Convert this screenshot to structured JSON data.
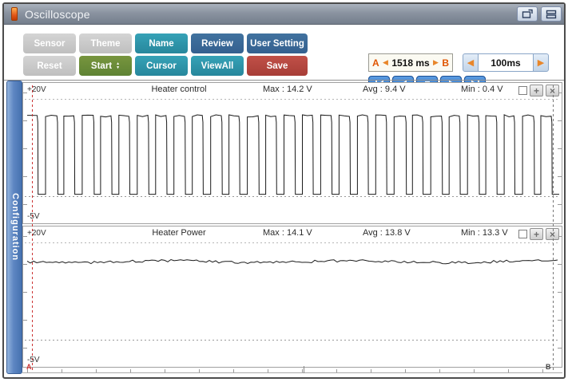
{
  "window": {
    "title": "Oscilloscope"
  },
  "toolbar": {
    "buttons": [
      {
        "label": "Sensor",
        "style": "gray"
      },
      {
        "label": "Theme",
        "style": "gray"
      },
      {
        "label": "Name",
        "style": "teal"
      },
      {
        "label": "Review",
        "style": "blue"
      },
      {
        "label": "User Setting",
        "style": "blue"
      },
      {
        "label": "Reset",
        "style": "gray"
      },
      {
        "label": "Start",
        "style": "green"
      },
      {
        "label": "Cursor",
        "style": "teal"
      },
      {
        "label": "ViewAll",
        "style": "teal"
      },
      {
        "label": "Save",
        "style": "red"
      }
    ],
    "range": {
      "a": "A",
      "value": "1518 ms",
      "b": "B"
    },
    "interval": {
      "value": "100ms"
    }
  },
  "sidebar": {
    "label": "Configuration"
  },
  "charts": [
    {
      "y_top": "+20V",
      "y_bottom": "-5V",
      "name": "Heater control",
      "max": "Max : 14.2 V",
      "avg": "Avg : 9.4 V",
      "min": "Min : 0.4 V"
    },
    {
      "y_top": "+20V",
      "y_bottom": "-5V",
      "name": "Heater Power",
      "max": "Max : 14.1 V",
      "avg": "Avg : 13.8 V",
      "min": "Min : 13.3 V"
    }
  ],
  "cursors": {
    "a": "A",
    "b": "B"
  },
  "icons": {
    "prev": "◀",
    "next": "▶",
    "up": "▲",
    "down": "▼",
    "plus": "+",
    "close": "×"
  },
  "colors": {
    "teal": "#2e96ad",
    "blue": "#39659b",
    "green": "#6a8f3c",
    "red": "#b7473f",
    "gray": "#c6c6c6",
    "playback_blue": "#2f74c8",
    "accent_orange": "#e05a00",
    "cursor_a": "#cc3333",
    "cursor_b": "#777777",
    "sidebar_blue": "#5d86c2"
  },
  "chart_data": [
    {
      "type": "line",
      "name": "Heater control",
      "waveform": "square",
      "unit": "V",
      "high_v": 14.2,
      "low_v": 0.4,
      "max_v": 14.2,
      "avg_v": 9.4,
      "min_v": 0.4,
      "cycles": 29,
      "duty": 0.57,
      "ylim": [
        -5,
        20
      ],
      "window_ms": 1518,
      "sample_interval": "100ms"
    },
    {
      "type": "line",
      "name": "Heater Power",
      "waveform": "noisy-flat",
      "unit": "V",
      "level_v": 13.8,
      "max_v": 14.1,
      "avg_v": 13.8,
      "min_v": 13.3,
      "noise_v": 0.35,
      "ylim": [
        -5,
        20
      ],
      "window_ms": 1518,
      "sample_interval": "100ms"
    }
  ]
}
